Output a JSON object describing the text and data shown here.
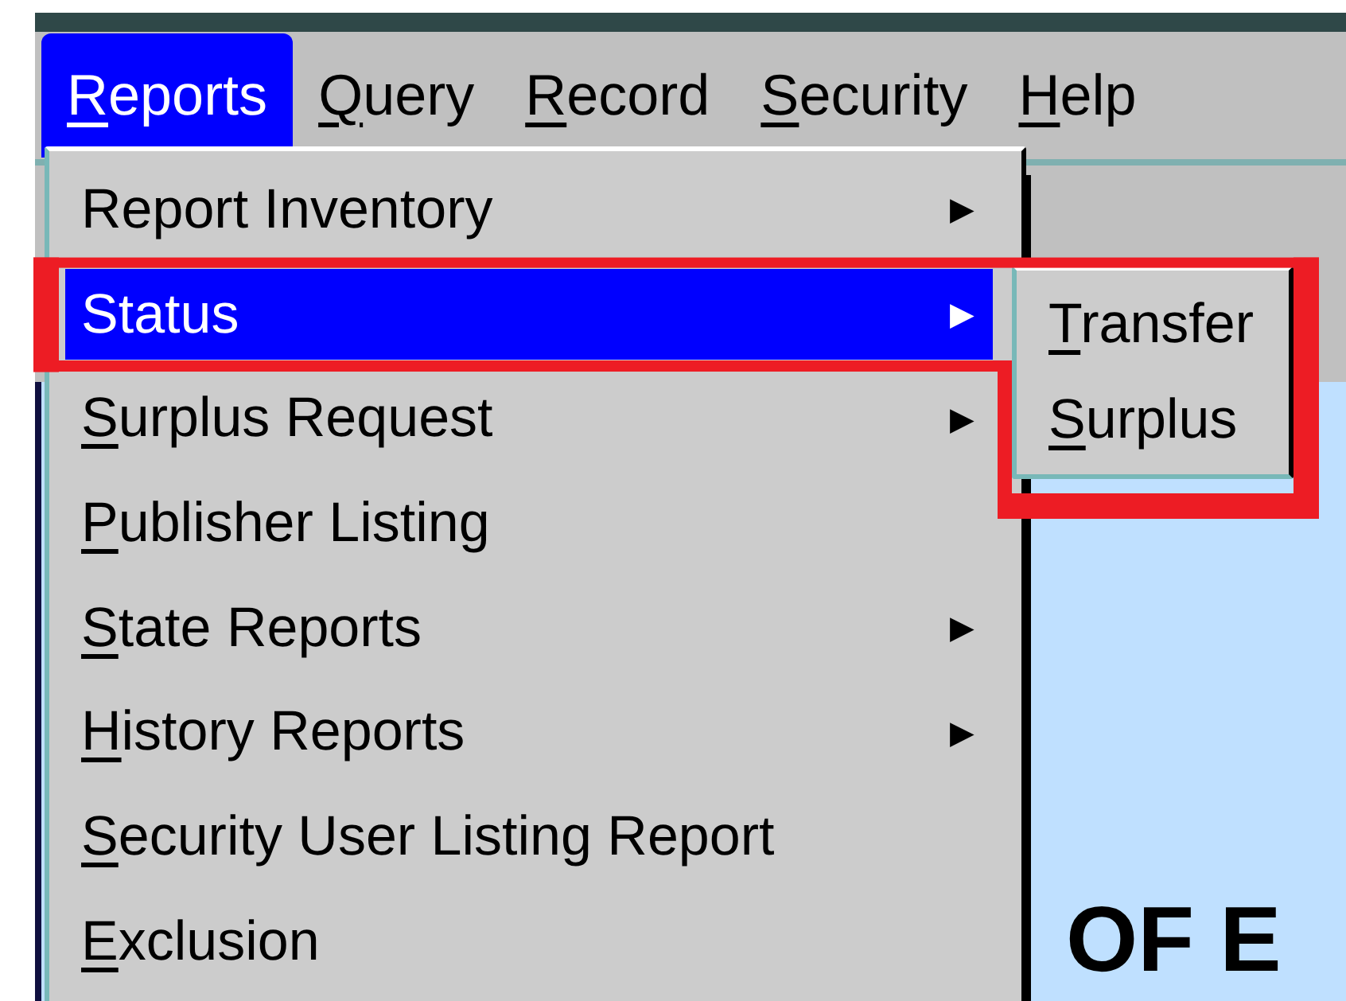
{
  "menubar": [
    {
      "label": "Reports",
      "mnemonic": true,
      "selected": true
    },
    {
      "label": "Query",
      "mnemonic": true,
      "selected": false
    },
    {
      "label": "Record",
      "mnemonic": true,
      "selected": false
    },
    {
      "label": "Security",
      "mnemonic": true,
      "selected": false
    },
    {
      "label": "Help",
      "mnemonic": true,
      "selected": false
    }
  ],
  "reports_menu": [
    {
      "label": "Report Inventory",
      "mnemonic": false,
      "submenu": true,
      "selected": false
    },
    {
      "label": "Status",
      "mnemonic": false,
      "submenu": true,
      "selected": true
    },
    {
      "label": "Surplus Request",
      "mnemonic": true,
      "submenu": true,
      "selected": false
    },
    {
      "label": "Publisher Listing",
      "mnemonic": true,
      "submenu": false,
      "selected": false
    },
    {
      "label": "State Reports",
      "mnemonic": true,
      "submenu": true,
      "selected": false
    },
    {
      "label": "History Reports",
      "mnemonic": true,
      "submenu": true,
      "selected": false
    },
    {
      "label": "Security User Listing Report",
      "mnemonic": true,
      "submenu": false,
      "selected": false
    },
    {
      "label": "Exclusion",
      "mnemonic": true,
      "submenu": false,
      "selected": false
    }
  ],
  "status_submenu": [
    {
      "label": "Transfer",
      "mnemonic": true,
      "selected": false
    },
    {
      "label": "Surplus",
      "mnemonic": true,
      "selected": false
    }
  ],
  "arrow": "▶",
  "background_heading": "OF E",
  "annotation": {
    "color": "#ed1c24"
  }
}
